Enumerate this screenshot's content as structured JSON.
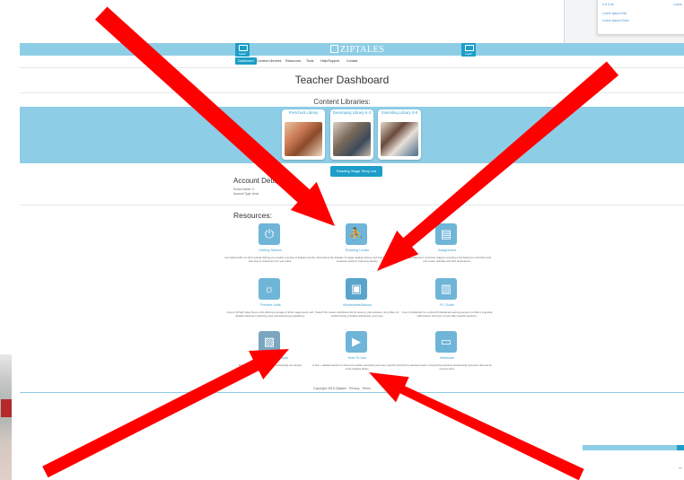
{
  "popup": {
    "lines": [
      "# # # ##",
      "Lorem Ipsum Bat",
      "Lorem Ipsum Dolor"
    ],
    "right_link": "Lorem"
  },
  "header": {
    "logo": "ZIPTALES",
    "left_button": "Search",
    "right_button": "Logout"
  },
  "nav": {
    "items": [
      "Dashboard",
      "Content Libraries",
      "Resources",
      "Tools",
      "Help/Support",
      "Contact"
    ]
  },
  "page": {
    "title": "Teacher Dashboard",
    "content_libraries_heading": "Content Libraries:",
    "libraries": [
      {
        "name": "Preschool Library"
      },
      {
        "name": "Developing Library K-3"
      },
      {
        "name": "Extending Library 3-8"
      }
    ],
    "reading_stage_button": "Reading Stage Story List",
    "account_heading": "Account Details",
    "account_lines": [
      "School Name: Ll",
      "Account Type: Annu"
    ],
    "resources_heading": "Resources:",
    "resources": [
      {
        "name": "Getting Started",
        "icon": "power-icon",
        "desc": "Get started with our short tutorial offering you a quick overview of Ziptales and the best way to customise it for your class."
      },
      {
        "name": "Reading Levels",
        "icon": "stairs-walker-icon",
        "desc": "Read about the Ziptales 17-stage reading scheme and how its readability measures assist in improving literacy."
      },
      {
        "name": "Assignment",
        "icon": "clipboard-icon",
        "desc": "Ziptales classroom curriculum aligned, covering a full classroom curriculum and unit review, activities and skill, and lessons."
      },
      {
        "name": "Themed Units",
        "icon": "lightbulb-icon",
        "desc": "A set of 16 high value theme units offering coverage of all six stage levels, with detailed classroom planning notes and assessment guidelines."
      },
      {
        "name": "Worksheets/Mocks",
        "icon": "teacher-board-icon",
        "desc": "Search the master worksheets list for lessons, plus answers, story titles, for student handy, printable worksheets, and more."
      },
      {
        "name": "PL Guide",
        "icon": "presentation-icon",
        "desc": "A set of guidelines for a school Professional Learning session so that in a general staff session and more of new class specific sessions."
      },
      {
        "name": "Ziptales: The Full Guide",
        "icon": "book-guide-icon",
        "desc": "Download this extensive 20 page developing set manual."
      },
      {
        "name": "How To Use",
        "icon": "video-play-icon",
        "desc": "A new + detailed section to show and explain everything and every specific parts of the Ziptales library."
      },
      {
        "name": "Webinars",
        "icon": "laptop-icon",
        "desc": "Find a selected series of supporting sessions and learning resources that can be used at short."
      }
    ]
  },
  "footer": {
    "copyright": "Copyright 2016 Ziptales · Privacy · Terms"
  },
  "colors": {
    "header_blue": "#8ecde6",
    "button_blue": "#1c9ec8",
    "icon_blue": "#6fb5d8",
    "arrow_red": "#ff0000"
  }
}
